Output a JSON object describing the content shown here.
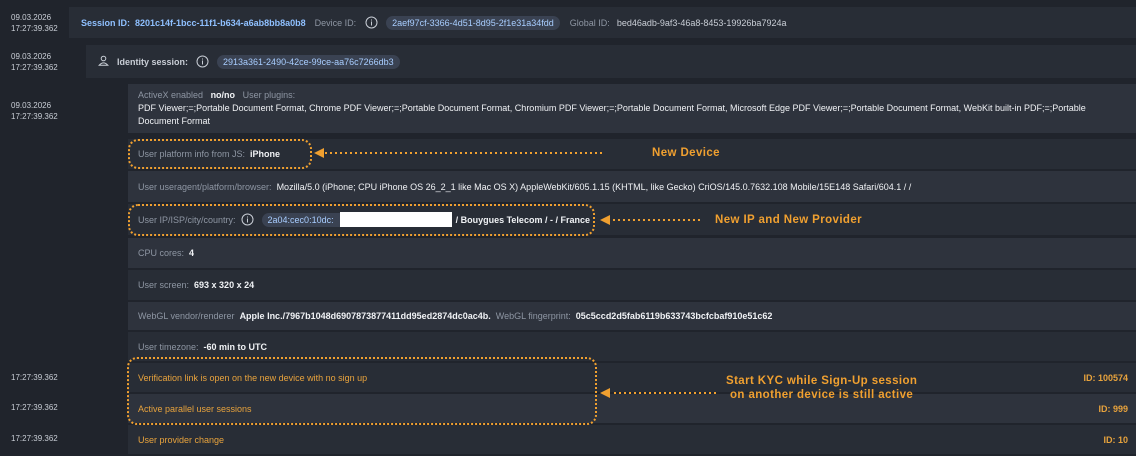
{
  "timestamps": [
    {
      "date": "09.03.2026",
      "time": "17:27:39.362"
    },
    {
      "date": "09.03.2026",
      "time": "17:27:39.362"
    },
    {
      "date": "09.03.2026",
      "time": "17:27:39.362"
    },
    {
      "time": "17:27:39.362"
    },
    {
      "time": "17:27:39.362"
    },
    {
      "time": "17:27:39.362"
    }
  ],
  "session": {
    "session_id_label": "Session ID:",
    "session_id": "8201c14f-1bcc-11f1-b634-a6ab8bb8a0b8",
    "device_id_label": "Device ID:",
    "device_id": "2aef97cf-3366-4d51-8d95-2f1e31a34fdd",
    "global_id_label": "Global ID:",
    "global_id": "bed46adb-9af3-46a8-8453-19926ba7924a"
  },
  "identity": {
    "label": "Identity session:",
    "value": "2913a361-2490-42ce-99ce-aa76c7266db3"
  },
  "details": {
    "activex_label": "ActiveX enabled",
    "activex_value": "no/no",
    "plugins_label": "User plugins:",
    "plugins_value": "PDF Viewer;=;Portable Document Format, Chrome PDF Viewer;=;Portable Document Format, Chromium PDF Viewer;=;Portable Document Format, Microsoft Edge PDF Viewer;=;Portable Document Format, WebKit built-in PDF;=;Portable Document Format",
    "platform_label": "User platform info from JS:",
    "platform_value": "iPhone",
    "useragent_label": "User useragent/platform/browser:",
    "useragent_value": "Mozilla/5.0 (iPhone; CPU iPhone OS 26_2_1 like Mac OS X) AppleWebKit/605.1.15 (KHTML, like Gecko) CriOS/145.0.7632.108 Mobile/15E148 Safari/604.1 / /",
    "ip_label": "User IP/ISP/city/country:",
    "ip_value": "2a04:cec0:10dc:",
    "ip_rest": "/ Bouygues Telecom / - / France",
    "cpu_label": "CPU cores:",
    "cpu_value": "4",
    "screen_label": "User screen:",
    "screen_value": "693 x 320 x 24",
    "webgl_label": "WebGL vendor/renderer",
    "webgl_value": "Apple Inc./7967b1048d6907873877411dd95ed2874dc0ac4b.",
    "fingerprint_label": "WebGL fingerprint:",
    "fingerprint_value": "05c5ccd2d5fab6119b633743bcfcbaf910e51c62",
    "timezone_label": "User timezone:",
    "timezone_value": "-60 min to UTC"
  },
  "events": [
    {
      "label": "Verification link is open on the new device with no sign up",
      "id": "ID: 100574"
    },
    {
      "label": "Active parallel user sessions",
      "id": "ID: 999"
    },
    {
      "label": "User provider change",
      "id": "ID: 10"
    }
  ],
  "annotations": {
    "new_device": "New Device",
    "new_ip": "New IP and New Provider",
    "kyc_line1": "Start KYC while Sign-Up session",
    "kyc_line2": "on another device is still active"
  },
  "colors": {
    "background": "#20242c",
    "accent_orange": "#f0a030",
    "link_blue": "#8fc0ff"
  }
}
